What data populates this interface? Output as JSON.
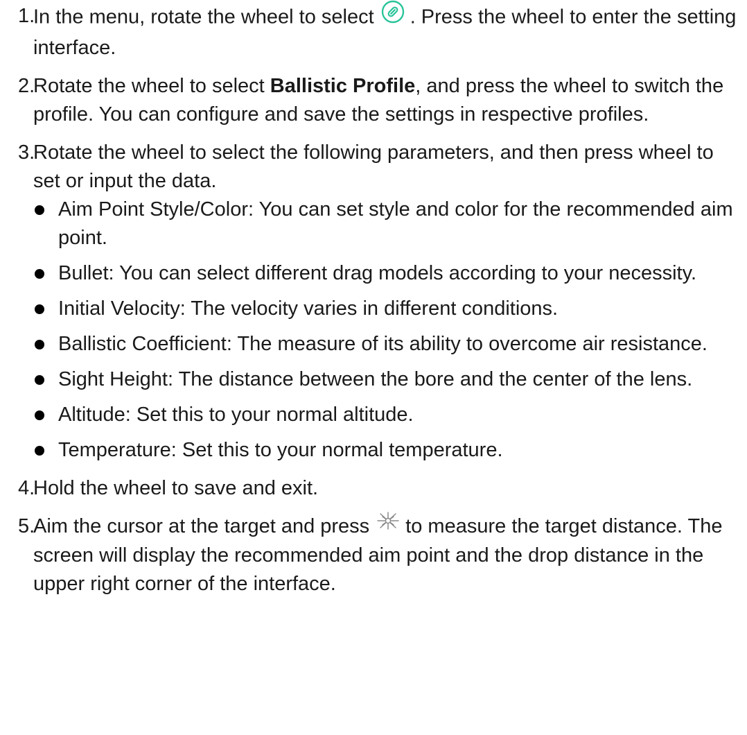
{
  "steps": [
    {
      "num": "1.",
      "before": "In the menu, rotate the wheel to select",
      "icon": "ballistic-wrench-circle-icon",
      "after": ". Press the wheel to enter the setting interface."
    },
    {
      "num": "2.",
      "before": "Rotate the wheel to select ",
      "bold": "Ballistic Profile",
      "after": ", and press the wheel to switch the profile. You can configure and save the settings in respective profiles."
    },
    {
      "num": "3.",
      "text": "Rotate the wheel to select the following parameters, and then press wheel to set or input the data.",
      "bullets": [
        "Aim Point Style/Color: You can set style and color for the recommended aim point.",
        "Bullet: You can select different drag models according to your necessity.",
        "Initial Velocity: The velocity varies in different conditions.",
        "Ballistic Coefficient: The measure of its ability to overcome air resistance.",
        "Sight Height: The distance between the bore and the center of the lens.",
        "Altitude: Set this to your normal altitude.",
        "Temperature: Set this to your normal temperature."
      ]
    },
    {
      "num": "4.",
      "text": "Hold the wheel to save and exit."
    },
    {
      "num": "5.",
      "before": "Aim the cursor at the target and press",
      "icon": "laser-rangefinder-icon",
      "after": "to measure the target distance. The screen will display the recommended aim point and the drop distance in the upper right corner of the interface."
    }
  ],
  "colors": {
    "text": "#1a1a1a",
    "icon_green": "#2bc49a",
    "icon_gray": "#8a8a8a"
  }
}
